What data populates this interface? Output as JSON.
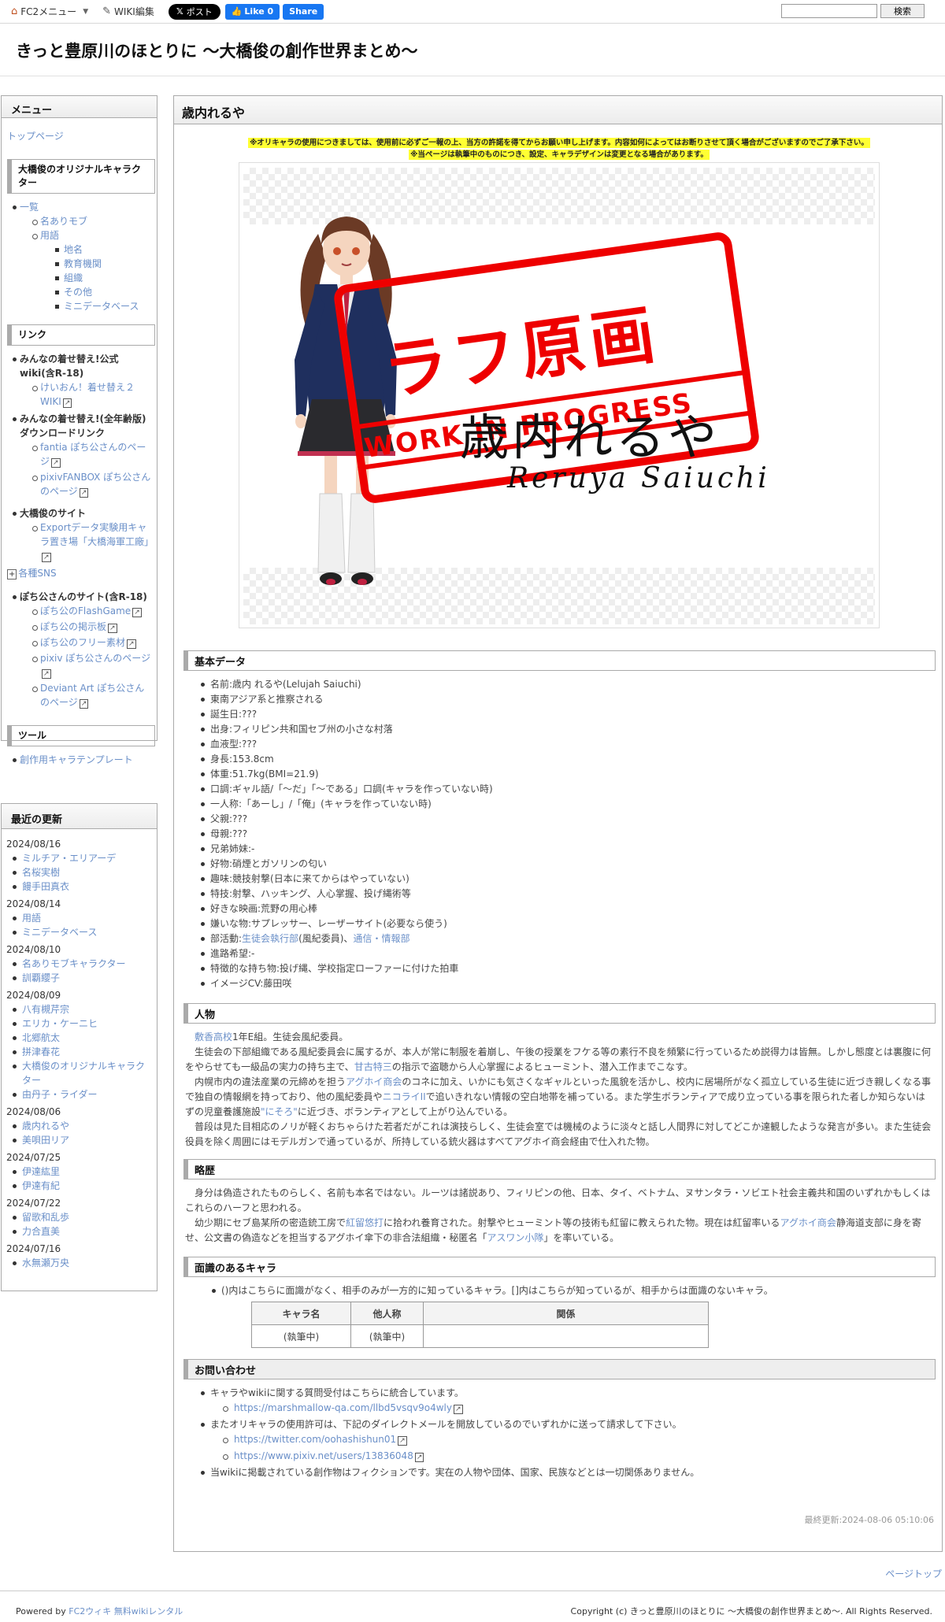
{
  "topbar": {
    "fc2_menu": "FC2メニュー",
    "wiki_edit": "WIKI編集",
    "x_post": "ポスト",
    "fb_like": "Like 0",
    "fb_share": "Share",
    "search_button": "検索",
    "search_value": ""
  },
  "site_title": "きっと豊原川のほとりに 〜大橋俊の創作世界まとめ〜",
  "menu": {
    "title": "メニュー",
    "top_page": "トップページ",
    "sec1": "大橋俊のオリジナルキャラクター",
    "sec1_items": [
      {
        "label": "一覧",
        "level": 1
      },
      {
        "label": "名ありモブ",
        "level": 2
      },
      {
        "label": "用語",
        "level": 2
      },
      {
        "label": "地名",
        "level": 3
      },
      {
        "label": "教育機関",
        "level": 3
      },
      {
        "label": "組織",
        "level": 3
      },
      {
        "label": "その他",
        "level": 3
      },
      {
        "label": "ミニデータベース",
        "level": 3
      }
    ],
    "sec2": "リンク",
    "link_a_title": "みんなの着せ替え!公式wiki(含R-18)",
    "link_a_1": "けいおん！着せ替え２WIKI",
    "link_b_title": "みんなの着せ替え!(全年齢版)ダウンロードリンク",
    "link_b_1": "fantia ぽち公さんのページ",
    "link_b_2": "pixivFANBOX ぽち公さんのページ",
    "link_c_title": "大橋俊のサイト",
    "link_c_1": "Exportデータ実験用キャラ置き場「大橋海軍工廠」",
    "sns": "各種SNS",
    "link_d_title": "ぽち公さんのサイト(含R-18)",
    "link_d_items": [
      "ぽち公のFlashGame",
      "ぽち公の掲示板",
      "ぽち公のフリー素材",
      "pixiv ぽち公さんのページ",
      "Deviant Art ぽち公さんのページ"
    ],
    "sec3": "ツール",
    "tool_1": "創作用キャラテンプレート"
  },
  "recent": {
    "title": "最近の更新",
    "groups": [
      {
        "date": "2024/08/16",
        "items": [
          "ミルチア・エリアーデ",
          "名桜実樹",
          "饅手田真衣"
        ]
      },
      {
        "date": "2024/08/14",
        "items": [
          "用語",
          "ミニデータベース"
        ]
      },
      {
        "date": "2024/08/10",
        "items": [
          "名ありモブキャラクター",
          "訓覇纓子"
        ]
      },
      {
        "date": "2024/08/09",
        "items": [
          "八有槻芹宗",
          "エリカ・ケーニヒ",
          "北郷航太",
          "拼津春花",
          "大橋俊のオリジナルキャラクター",
          "由丹子・ライダー"
        ]
      },
      {
        "date": "2024/08/06",
        "items": [
          "歳内れるや",
          "美唄田リア"
        ]
      },
      {
        "date": "2024/07/25",
        "items": [
          "伊達紘里",
          "伊達有紀"
        ]
      },
      {
        "date": "2024/07/22",
        "items": [
          "留歌和乱歩",
          "力合直美"
        ]
      },
      {
        "date": "2024/07/16",
        "items": [
          "水無瀬万央"
        ]
      }
    ]
  },
  "page": {
    "title": "歳内れるや",
    "notice1": "※オリキャラの使用につきましては、使用前に必ずご一報の上、当方の許諾を得てからお願い申し上げます。内容如何によってはお断りさせて頂く場合がございますのでご了承下さい。",
    "notice2": "※当ページは執筆中のものにつき、設定、キャラデザインは変更となる場合があります。",
    "figure": {
      "stamp_text": "ラフ原画",
      "stamp_band": "WORK IN PROGRESS",
      "name_ja": "歳内れるや",
      "name_en": "Reruya Saiuchi"
    },
    "basic": {
      "heading": "基本データ",
      "items": [
        "名前:歳内 れるや(Lelujah Saiuchi)",
        "東南アジア系と推察される",
        "誕生日:???",
        "出身:フィリピン共和国セブ州の小さな村落",
        "血液型:???",
        "身長:153.8cm",
        "体重:51.7kg(BMI=21.9)",
        "口調:ギャル語/「〜だ」「〜である」口調(キャラを作っていない時)",
        "一人称:「あーし」/「俺」(キャラを作っていない時)",
        "父親:???",
        "母親:???",
        "兄弟姉妹:-",
        "好物:硝煙とガソリンの匂い",
        "趣味:競技射撃(日本に来てからはやっていない)",
        "特技:射撃、ハッキング、人心掌握、投げ縄術等",
        "好きな映画:荒野の用心棒",
        "嫌いな物:サプレッサー、レーザーサイト(必要なら使う)"
      ],
      "club_prefix": "部活動:",
      "club_link1": "生徒会執行部",
      "club_mid": "(風紀委員)、",
      "club_link2": "通信・情報部",
      "items_after": [
        "進路希望:-",
        "特徴的な持ち物:投げ縄、学校指定ローファーに付けた拍車",
        "イメージCV:藤田咲"
      ]
    },
    "person": {
      "heading": "人物",
      "p1_link": "敷香高校",
      "p1_rest": "1年E組。生徒会風紀委員。",
      "p2a": "生徒会の下部組織である風紀委員会に属するが、本人が常に制服を着崩し、午後の授業をフケる等の素行不良を頻繁に行っているため説得力は皆無。しかし態度とは裏腹に何をやらせても一級品の実力の持ち主で、",
      "p2_link": "甘古特三",
      "p2b": "の指示で盗聴から人心掌握によるヒューミント、潜入工作までこなす。",
      "p3a": "内幌市内の違法産業の元締めを担う",
      "p3_link1": "アグホイ商会",
      "p3b": "のコネに加え、いかにも気さくなギャルといった風貌を活かし、校内に居場所がなく孤立している生徒に近づき親しくなる事で独自の情報網を持っており、他の風紀委員や",
      "p3_link2": "ニコライII",
      "p3c": "で追いきれない情報の空白地帯を補っている。また学生ボランティアで成り立っている事を限られた者しか知らないはずの児童養護施設",
      "p3_link3": "\"にそろ\"",
      "p3d": "に近づき、ボランティアとして上がり込んでいる。",
      "p4": "普段は見た目相応のノリが軽くおちゃらけた若者だがこれは演技らしく、生徒会室では機械のように淡々と話し人間界に対してどこか達観したような発言が多い。また生徒会役員を除く周囲にはモデルガンで通っているが、所持している銃火器はすべてアグホイ商会経由で仕入れた物。"
    },
    "history": {
      "heading": "略歴",
      "p1": "身分は偽造されたものらしく、名前も本名ではない。ルーツは諸説あり、フィリピンの他、日本、タイ、ベトナム、ヌサンタラ・ソビエト社会主義共和国のいずれかもしくはこれらのハーフと思われる。",
      "p2a": "幼少期にセブ島某所の密造銃工房で",
      "p2_link1": "紅留悠打",
      "p2b": "に拾われ養育された。射撃やヒューミント等の技術も紅留に教えられた物。現在は紅留率いる",
      "p2_link2": "アグホイ商会",
      "p2c": "静海道支部に身を寄せ、公文書の偽造などを担当するアグホイ傘下の非合法組織・秘匿名「",
      "p2_link3": "アスワン小隊",
      "p2d": "」を率いている。"
    },
    "acquaint": {
      "heading": "面識のあるキャラ",
      "note": "()内はこちらに面識がなく、相手のみが一方的に知っているキャラ。[]内はこちらが知っているが、相手からは面識のないキャラ。",
      "headers": [
        "キャラ名",
        "他人称",
        "関係"
      ],
      "rows": [
        [
          "(執筆中)",
          "(執筆中)",
          ""
        ]
      ]
    },
    "contact": {
      "heading": "お問い合わせ",
      "i1": "キャラやwikiに関する質問受付はこちらに統合しています。",
      "i1_link": "https://marshmallow-qa.com/llbd5vsqv9o4wly",
      "i2": "またオリキャラの使用許可は、下記のダイレクトメールを開放しているのでいずれかに送って請求して下さい。",
      "i2_link1": "https://twitter.com/oohashishun01",
      "i2_link2": "https://www.pixiv.net/users/13836048",
      "i3": "当wikiに掲載されている創作物はフィクションです。実在の人物や団体、国家、民族などとは一切関係ありません。"
    },
    "last_updated": "最終更新:2024-08-06 05:10:06"
  },
  "page_top": "ページトップ",
  "footer": {
    "powered_prefix": "Powered by",
    "powered_link": "FC2ウィキ 無料wikiレンタル",
    "copyright": "Copyright (c) きっと豊原川のほとりに 〜大橋俊の創作世界まとめ〜. All Rights Reserved."
  }
}
